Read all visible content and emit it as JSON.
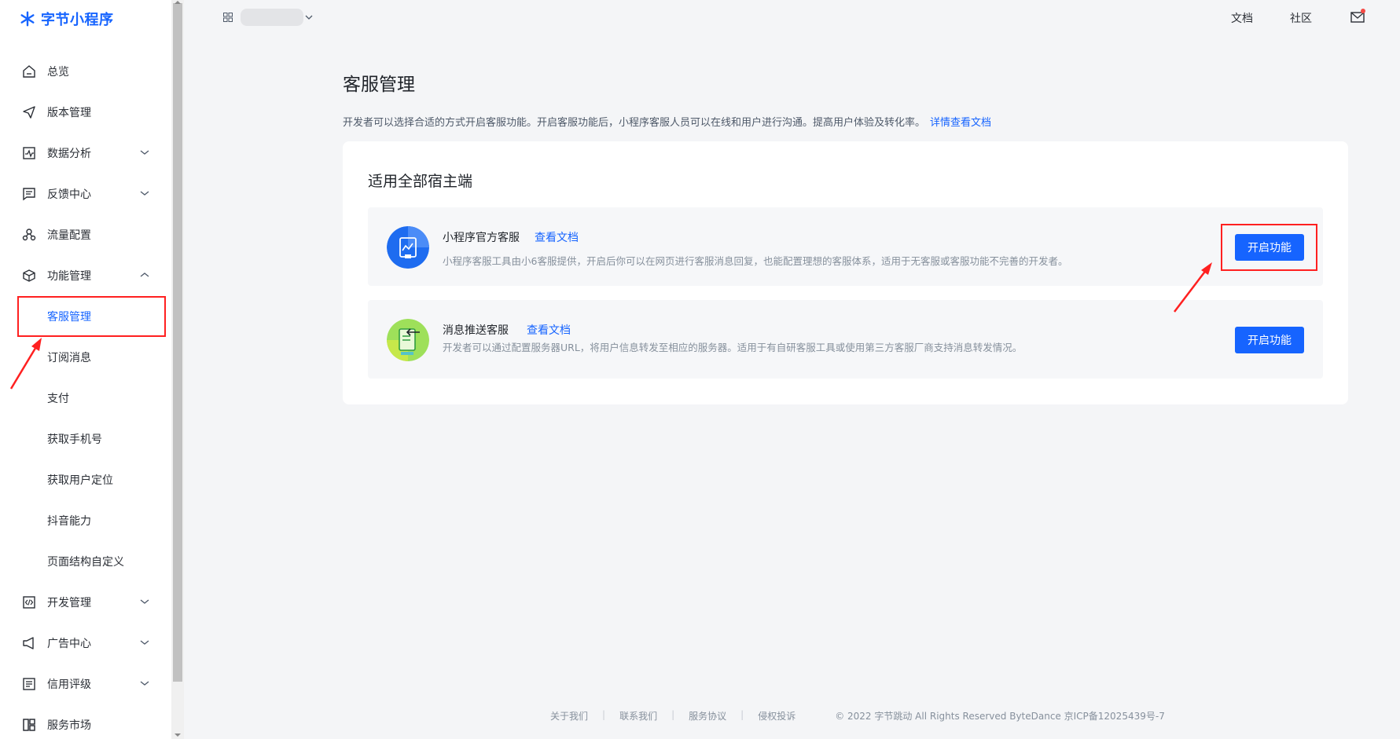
{
  "brand": {
    "name": "字节小程序",
    "accent": "#1664ff"
  },
  "topbar": {
    "docs": "文档",
    "community": "社区"
  },
  "sidebar": {
    "items": [
      {
        "label": "总览",
        "icon": "home-icon"
      },
      {
        "label": "版本管理",
        "icon": "send-icon"
      },
      {
        "label": "数据分析",
        "icon": "chart-icon",
        "expandable": true
      },
      {
        "label": "反馈中心",
        "icon": "feedback-icon",
        "expandable": true
      },
      {
        "label": "流量配置",
        "icon": "traffic-icon"
      },
      {
        "label": "功能管理",
        "icon": "cube-icon",
        "expanded": true
      }
    ],
    "sub_items": [
      {
        "label": "客服管理",
        "active": true
      },
      {
        "label": "订阅消息"
      },
      {
        "label": "支付"
      },
      {
        "label": "获取手机号"
      },
      {
        "label": "获取用户定位"
      },
      {
        "label": "抖音能力"
      },
      {
        "label": "页面结构自定义"
      }
    ],
    "bottom_items": [
      {
        "label": "开发管理",
        "icon": "code-icon",
        "expandable": true
      },
      {
        "label": "广告中心",
        "icon": "megaphone-icon",
        "expandable": true
      },
      {
        "label": "信用评级",
        "icon": "rating-icon",
        "expandable": true
      },
      {
        "label": "服务市场",
        "icon": "grid-icon"
      }
    ]
  },
  "main": {
    "title": "客服管理",
    "description": "开发者可以选择合适的方式开启客服功能。开启客服功能后，小程序客服人员可以在线和用户进行沟通。提高用户体验及转化率。",
    "doc_link": "详情查看文档",
    "card_title": "适用全部宿主端",
    "services": [
      {
        "name": "小程序官方客服",
        "doc_link": "查看文档",
        "description": "小程序客服工具由小6客服提供，开启后你可以在网页进行客服消息回复，也能配置理想的客服体系，适用于无客服或客服功能不完善的开发者。",
        "button": "开启功能"
      },
      {
        "name": "消息推送客服",
        "doc_link": "查看文档",
        "description": "开发者可以通过配置服务器URL，将用户信息转发至相应的服务器。适用于有自研客服工具或使用第三方客服厂商支持消息转发情况。",
        "button": "开启功能"
      }
    ]
  },
  "footer": {
    "links": [
      "关于我们",
      "联系我们",
      "服务协议",
      "侵权投诉"
    ],
    "copyright": "© 2022 字节跳动 All Rights Reserved ByteDance 京ICP备12025439号-7"
  }
}
